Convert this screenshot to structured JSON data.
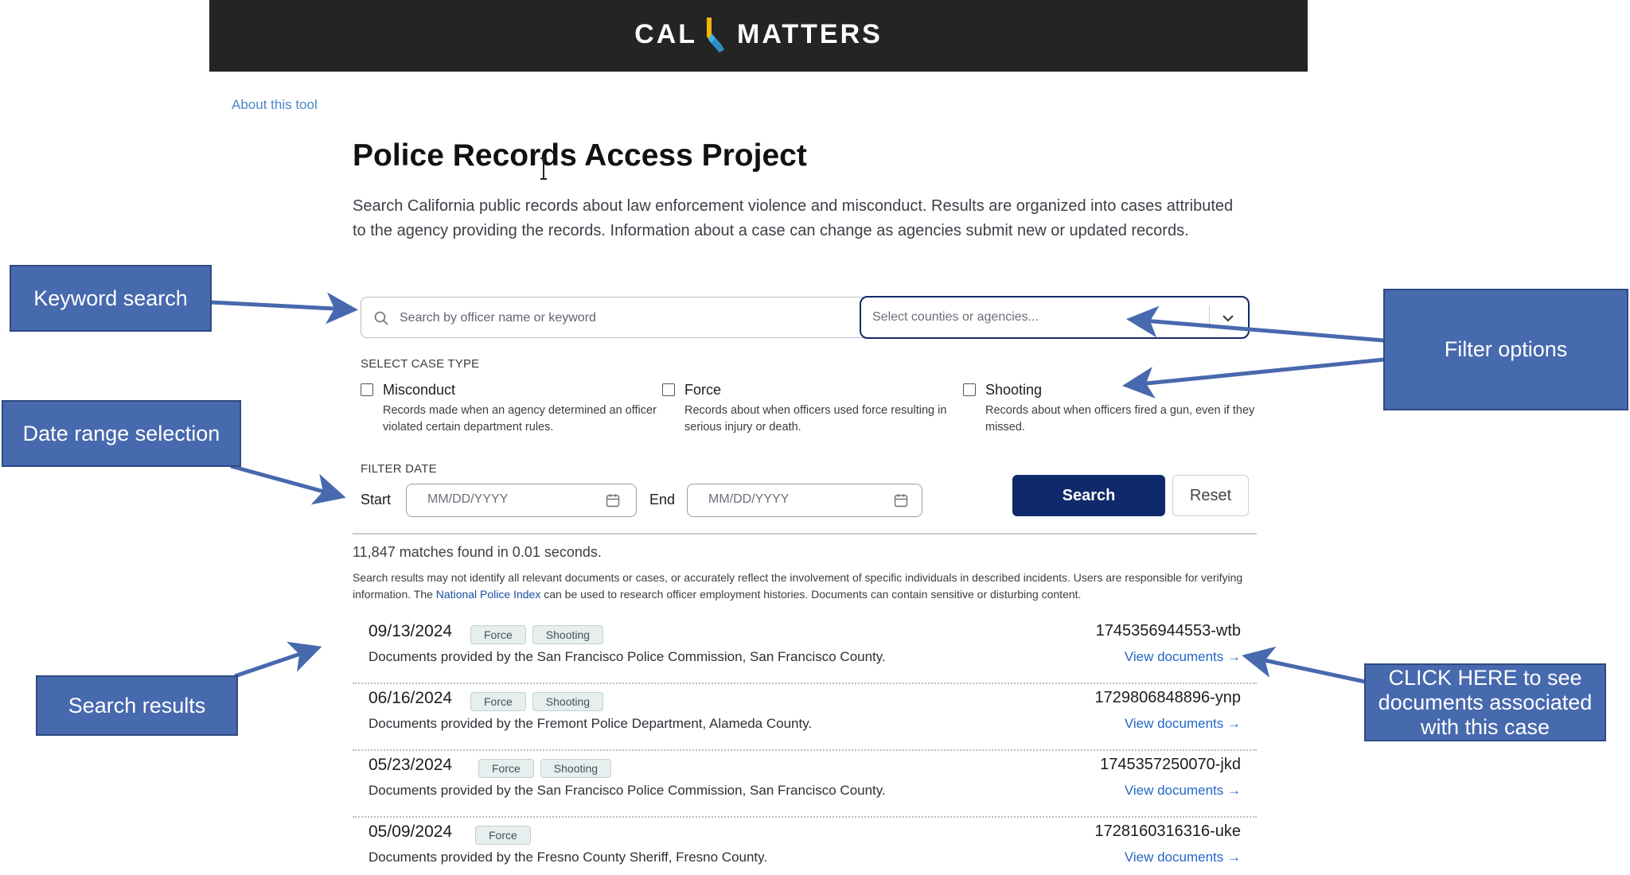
{
  "header": {
    "logo_left": "CAL",
    "logo_right": "MATTERS",
    "logo_colors": {
      "background": "#242424",
      "mark_yellow": "#f5b400",
      "mark_blue": "#3bb5e8"
    }
  },
  "nav": {
    "about_link": "About this tool"
  },
  "page": {
    "title": "Police Records Access Project",
    "intro": "Search California public records about law enforcement violence and misconduct. Results are organized into cases attributed to the agency providing the records. Information about a case can change as agencies submit new or updated records."
  },
  "search": {
    "placeholder": "Search by officer name or keyword",
    "value": "",
    "agency_placeholder": "Select counties or agencies..."
  },
  "case_type": {
    "label": "SELECT CASE TYPE",
    "options": [
      {
        "title": "Misconduct",
        "desc": "Records made when an agency determined an officer violated certain department rules.",
        "checked": false
      },
      {
        "title": "Force",
        "desc": "Records about when officers used force resulting in serious injury or death.",
        "checked": false
      },
      {
        "title": "Shooting",
        "desc": "Records about when officers fired a gun, even if they missed.",
        "checked": false
      }
    ]
  },
  "date_filter": {
    "label": "FILTER DATE",
    "start_label": "Start",
    "end_label": "End",
    "start_placeholder": "MM/DD/YYYY",
    "end_placeholder": "MM/DD/YYYY"
  },
  "actions": {
    "search": "Search",
    "reset": "Reset"
  },
  "results_meta": {
    "count": "11,847 matches found in 0.01 seconds.",
    "disclaimer_pre": "Search results may not identify all relevant documents or cases, or accurately reflect the involvement of specific individuals in described incidents. Users are responsible for verifying information. The ",
    "disclaimer_link": "National Police Index",
    "disclaimer_post": " can be used to research officer employment histories. Documents can contain sensitive or disturbing content."
  },
  "results": [
    {
      "date": "09/13/2024",
      "tags": [
        "Force",
        "Shooting"
      ],
      "desc": "Documents provided by the San Francisco Police Commission, San Francisco County.",
      "id": "1745356944553-wtb",
      "link": "View documents →"
    },
    {
      "date": "06/16/2024",
      "tags": [
        "Force",
        "Shooting"
      ],
      "desc": "Documents provided by the Fremont Police Department, Alameda County.",
      "id": "1729806848896-ynp",
      "link": "View documents →"
    },
    {
      "date": "05/23/2024",
      "tags": [
        "Force",
        "Shooting"
      ],
      "desc": "Documents provided by the San Francisco Police Commission, San Francisco County.",
      "id": "1745357250070-jkd",
      "link": "View documents →"
    },
    {
      "date": "05/09/2024",
      "tags": [
        "Force"
      ],
      "desc": "Documents provided by the Fresno County Sheriff, Fresno County.",
      "id": "1728160316316-uke",
      "link": "View documents →"
    }
  ],
  "annotations": {
    "keyword": "Keyword search",
    "date_range": "Date range selection",
    "filter": "Filter options",
    "results": "Search results",
    "click_here": "CLICK HERE to see documents associated with this case",
    "color": "#4769ad"
  }
}
